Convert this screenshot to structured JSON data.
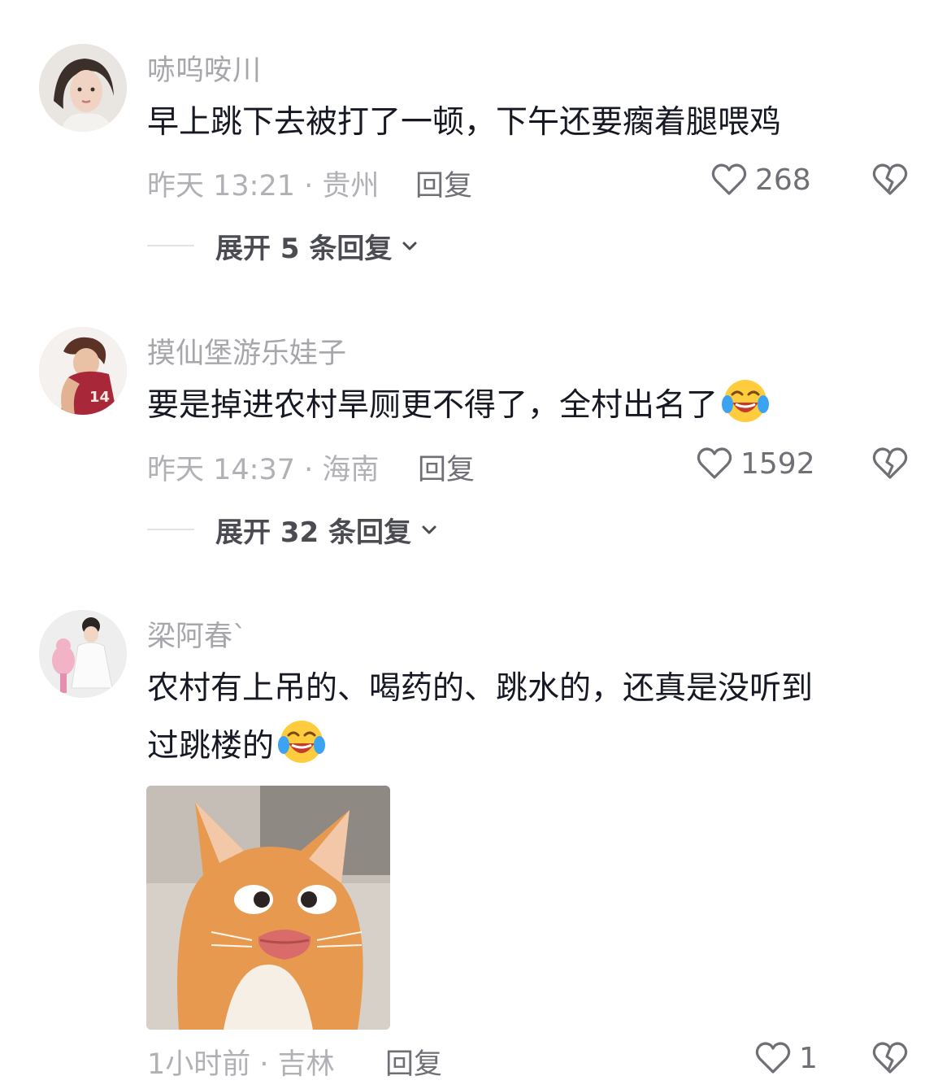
{
  "comments": [
    {
      "username": "哧呜咹川",
      "text_lines": [
        "早上跳下去被打了一顿，下午还要瘸着腿喂鸡"
      ],
      "time_location": "昨天 13:21 · 贵州",
      "reply_label": "回复",
      "likes": "268",
      "expand_label": "展开 5 条回复"
    },
    {
      "username": "摸仙堡游乐娃子",
      "text_lines": [
        "要是掉进农村旱厕更不得了，全村出名了"
      ],
      "time_location": "昨天 14:37 · 海南",
      "reply_label": "回复",
      "likes": "1592",
      "expand_label": "展开 32 条回复"
    },
    {
      "username": "梁阿春`",
      "text_lines": [
        "农村有上吊的、喝药的、跳水的，还真是没听到",
        "过跳楼的"
      ],
      "time_location": "1小时前 · 吉林",
      "reply_label": "回复",
      "likes": "1"
    }
  ],
  "icons": {
    "like": "heart-outline-icon",
    "dislike": "broken-heart-icon",
    "expand": "chevron-down-icon",
    "emoji": "laughing-tears-emoji"
  }
}
